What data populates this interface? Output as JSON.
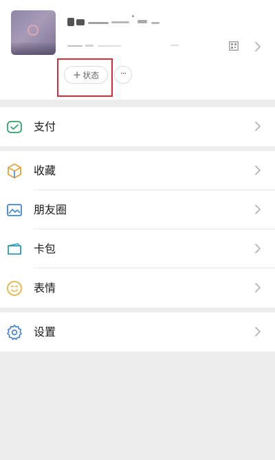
{
  "profile": {
    "status_label": "状态",
    "status_plus": "+",
    "more_label": "···"
  },
  "menu": {
    "groups": [
      {
        "items": [
          {
            "label": "支付"
          }
        ]
      },
      {
        "items": [
          {
            "label": "收藏"
          },
          {
            "label": "朋友圈"
          },
          {
            "label": "卡包"
          },
          {
            "label": "表情"
          }
        ]
      },
      {
        "items": [
          {
            "label": "设置"
          }
        ]
      }
    ]
  },
  "colors": {
    "accent_green": "#07A85C",
    "pay_green": "#2DA36B",
    "favorites_orange": "#E8A13A",
    "moments_blue": "#3F86D6",
    "cards_teal": "#2E9BB4",
    "stickers_yellow": "#E8B33C",
    "settings_blue": "#3E7FD1",
    "highlight_red": "#D92A35"
  },
  "icons": {
    "pay": "pay-icon",
    "favorites": "favorites-icon",
    "moments": "moments-icon",
    "cards": "card-package-icon",
    "stickers": "sticker-icon",
    "settings": "settings-gear-icon",
    "qr": "qr-code-icon",
    "chevron": "chevron-right-icon"
  }
}
